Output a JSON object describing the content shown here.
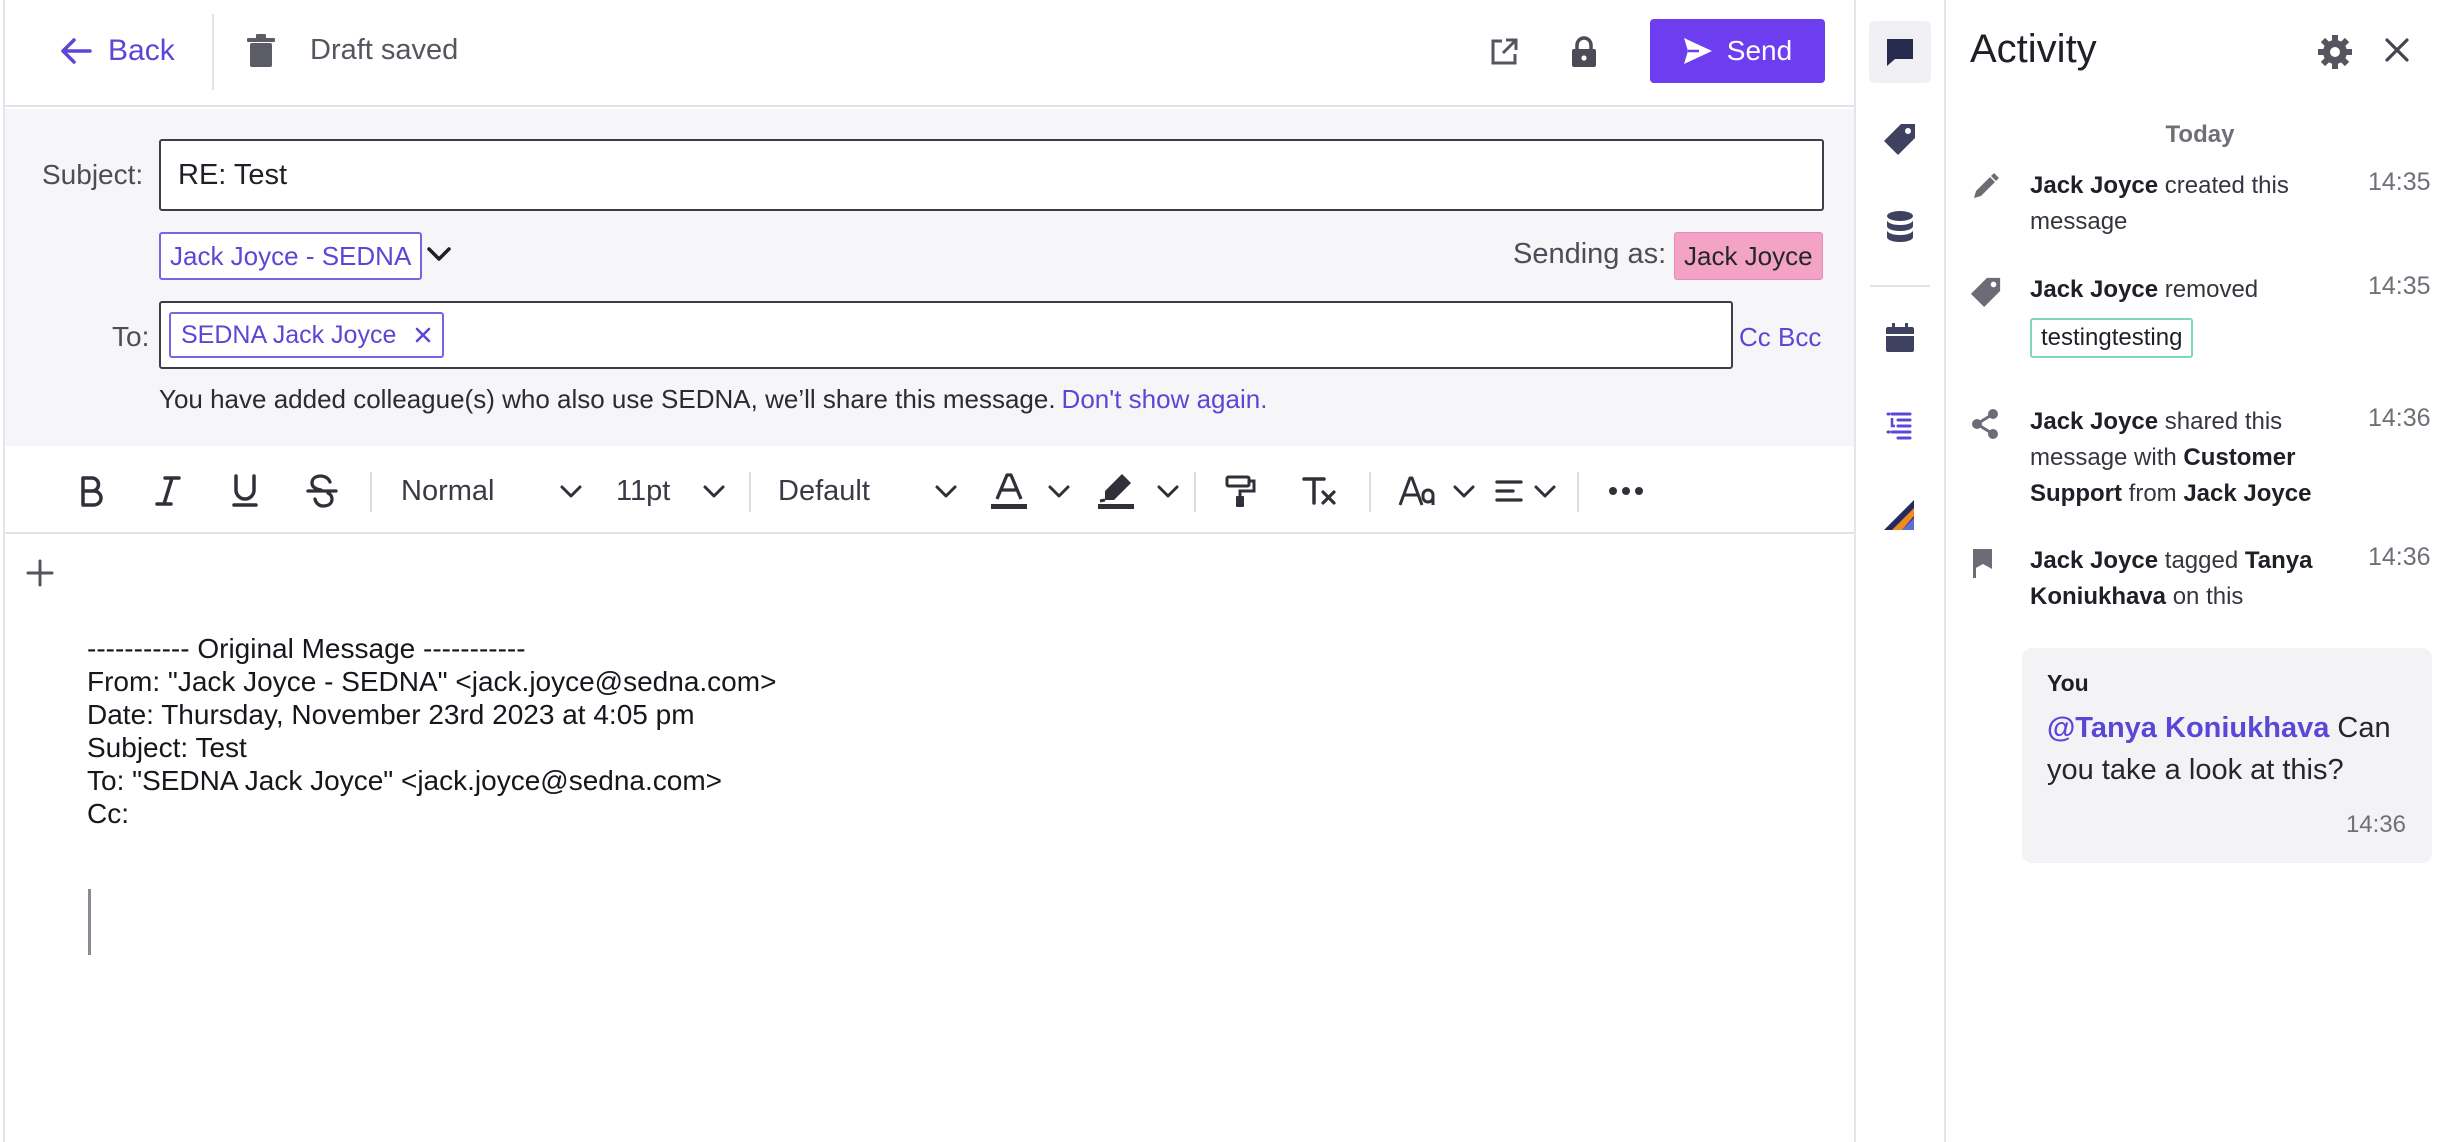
{
  "header": {
    "back_label": "Back",
    "draft_status": "Draft saved",
    "send_label": "Send"
  },
  "compose": {
    "subject_label": "Subject:",
    "subject_value": "RE: Test",
    "from_account": "Jack Joyce - SEDNA",
    "sending_as_label": "Sending as:",
    "sending_as_value": "Jack Joyce",
    "to_label": "To:",
    "to_recipient": "SEDNA Jack Joyce",
    "cc_bcc": "Cc Bcc",
    "notice_text": "You have added colleague(s) who also use SEDNA, we’ll share this message.",
    "notice_link": "Don't show again."
  },
  "toolbar": {
    "paragraph_style": "Normal",
    "font_size": "11pt",
    "font_family": "Default"
  },
  "body": {
    "lines": [
      "----------- Original Message -----------",
      "From: \"Jack Joyce - SEDNA\" <jack.joyce@sedna.com>",
      "Date: Thursday, November 23rd 2023 at 4:05 pm",
      "Subject: Test",
      "To: \"SEDNA Jack Joyce\" <jack.joyce@sedna.com>",
      "Cc:"
    ]
  },
  "activity": {
    "title": "Activity",
    "day": "Today",
    "entries": [
      {
        "actor": "Jack Joyce",
        "text": " created this message",
        "time": "14:35",
        "icon": "pencil-icon"
      },
      {
        "actor": "Jack Joyce",
        "text": " removed",
        "tag": "testingtesting",
        "time": "14:35",
        "icon": "tag-icon"
      },
      {
        "actor": "Jack Joyce",
        "text1": " shared this message with ",
        "target": "Customer Support",
        "text2": " from ",
        "actor2": "Jack Joyce",
        "time": "14:36",
        "icon": "share-icon"
      },
      {
        "actor": "Jack Joyce",
        "text1": " tagged ",
        "target": "Tanya Koniukhava",
        "text2": " on this",
        "time": "14:36",
        "icon": "flag-icon"
      }
    ],
    "comment": {
      "author": "You",
      "mention": "@Tanya Koniukhava",
      "text": " Can you take a look at this?",
      "time": "14:36"
    }
  },
  "colors": {
    "accent": "#6d3ef0",
    "link": "#5b47d6",
    "sending_chip": "#f3a4c6",
    "tag_border": "#7fd9b2"
  }
}
